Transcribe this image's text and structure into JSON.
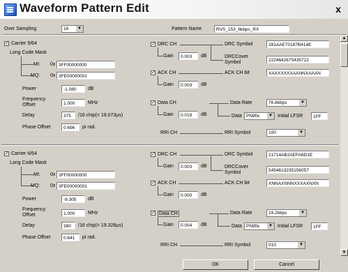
{
  "window": {
    "title": "Waveform Pattern Edit",
    "close_label": "x"
  },
  "header": {
    "over_sampling_label": "Over Sampling",
    "over_sampling_value": "16",
    "pattern_name_label": "Pattern Name",
    "pattern_name_value": "RVS_153_6kbps_RX"
  },
  "labels": {
    "long_code_mask": "Long Code Mask",
    "mi": "MI:",
    "mq": "MQ:",
    "hex_prefix": "0x",
    "power": "Power",
    "db": "dB",
    "frequency_offset_1": "Frequency",
    "frequency_offset_2": "Offset",
    "mhz": "MHz",
    "delay": "Delay",
    "phase_offset": "Phase Offset",
    "pi_rad": "pi rad.",
    "drc_ch": "DRC CH",
    "gain": "Gain",
    "drc_symbol": "DRC Symbol",
    "drccover_1": "DRCCover",
    "drccover_2": "Symbol",
    "ack_ch": "ACK CH",
    "ack_ch_bit": "ACK CH bit",
    "data_ch": "Data CH",
    "data_rate": "Data Rate",
    "data": "Data",
    "initial_lfsr": "Initial LFSR",
    "rri_ch": "RRI CH",
    "rri_symbol": "RRI Symbol"
  },
  "carriers": [
    {
      "label": "Carrier 5/64",
      "mi": "3FF00000000",
      "mq": "3FE00000001",
      "power": "-1.080",
      "freq_offset": "1.000",
      "delay": "375",
      "delay_note": "/16 chip(= 19.073µs)",
      "phase_offset": "0.696",
      "drc_gain": "0.003",
      "drc_symbol": "281AAE70187B414E",
      "drccover_symbol": "2224642675435722",
      "ack_gain": "0.003",
      "ack_bit": "XAXXXXXXAANNXAAAN",
      "data_gain": "0.019",
      "data_rate": "76.8kbps",
      "data_value": "PN9fix",
      "initial_lfsr": "1FF",
      "rri_symbol": "100"
    },
    {
      "label": "Carrier 6/64",
      "mi": "3FF00000000",
      "mq": "3FE00000001",
      "power": "-9.305",
      "freq_offset": "1.000",
      "delay": "380",
      "delay_note": "/16 chip(= 19.328µs)",
      "phase_offset": "0.641",
      "drc_gain": "0.003",
      "drc_symbol": "21714AB2AEFA6D1E",
      "drccover_symbol": "5454613235156057",
      "ack_gain": "0.000",
      "ack_bit": "XNNAXNNNXXXAXNXN",
      "data_gain": "0.004",
      "data_rate": "19.2kbps",
      "data_value": "PN9fix",
      "initial_lfsr": "1FF",
      "rri_symbol": "010"
    }
  ],
  "footer": {
    "ok": "OK",
    "cancel": "Cancel"
  }
}
